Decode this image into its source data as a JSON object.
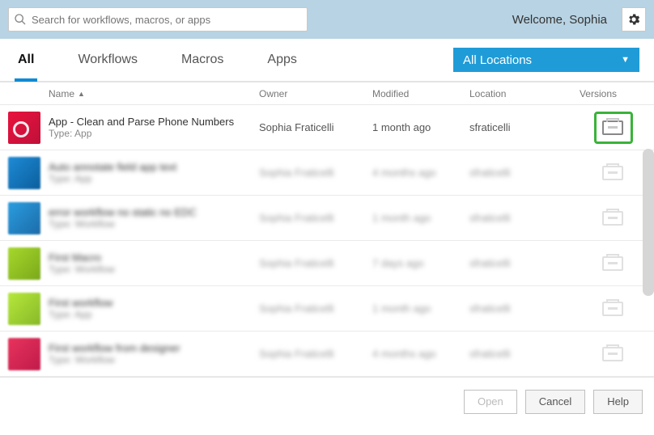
{
  "search": {
    "placeholder": "Search for workflows, macros, or apps"
  },
  "welcome": {
    "prefix": "Welcome, ",
    "user": "Sophia"
  },
  "tabs": {
    "all": "All",
    "workflows": "Workflows",
    "macros": "Macros",
    "apps": "Apps"
  },
  "location_filter": {
    "label": "All Locations"
  },
  "columns": {
    "name": "Name",
    "owner": "Owner",
    "modified": "Modified",
    "location": "Location",
    "versions": "Versions"
  },
  "rows": [
    {
      "title": "App - Clean and Parse Phone Numbers",
      "subtitle": "Type: App",
      "owner": "Sophia Fraticelli",
      "modified": "1 month ago",
      "location": "sfraticelli"
    },
    {
      "title": "Auto annotate field app text",
      "subtitle": "Type: App",
      "owner": "Sophia Fraticelli",
      "modified": "4 months ago",
      "location": "sfraticelli"
    },
    {
      "title": "error workflow no static no EDC",
      "subtitle": "Type: Workflow",
      "owner": "Sophia Fraticelli",
      "modified": "1 month ago",
      "location": "sfraticelli"
    },
    {
      "title": "First Macro",
      "subtitle": "Type: Workflow",
      "owner": "Sophia Fraticelli",
      "modified": "7 days ago",
      "location": "sfraticelli"
    },
    {
      "title": "First workflow",
      "subtitle": "Type: App",
      "owner": "Sophia Fraticelli",
      "modified": "1 month ago",
      "location": "sfraticelli"
    },
    {
      "title": "First workflow from designer",
      "subtitle": "Type: Workflow",
      "owner": "Sophia Fraticelli",
      "modified": "4 months ago",
      "location": "sfraticelli"
    }
  ],
  "buttons": {
    "open": "Open",
    "cancel": "Cancel",
    "help": "Help"
  }
}
